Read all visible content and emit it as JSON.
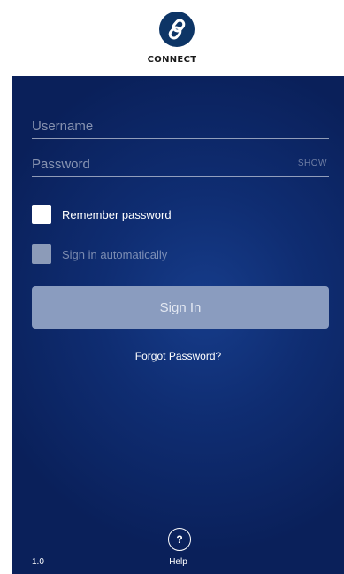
{
  "app": {
    "logo_text": "CONNECT",
    "logo_icon": "chain-link-icon",
    "brand_color": "#0d3566",
    "panel_color": "#0f2d72"
  },
  "login": {
    "username_placeholder": "Username",
    "password_placeholder": "Password",
    "show_label": "SHOW",
    "remember_label": "Remember password",
    "remember_checked": false,
    "auto_label": "Sign in automatically",
    "auto_enabled": false,
    "signin_label": "Sign In",
    "forgot_label": "Forgot Password?"
  },
  "footer": {
    "help_icon": "question-icon",
    "help_symbol": "?",
    "help_label": "Help",
    "version": "1.0"
  }
}
